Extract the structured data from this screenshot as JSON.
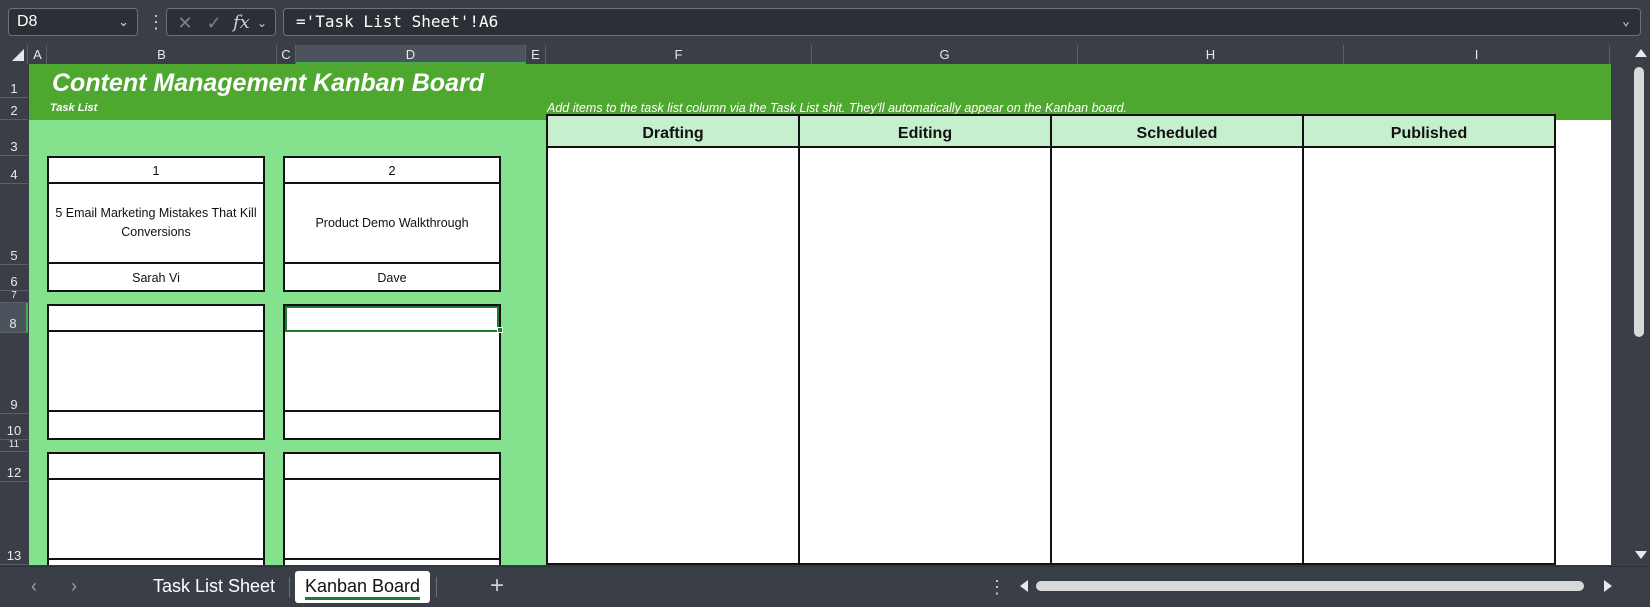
{
  "formula_bar": {
    "name_box": "D8",
    "formula": "='Task List Sheet'!A6",
    "fx_label": "fx"
  },
  "columns": [
    "A",
    "B",
    "C",
    "D",
    "E",
    "F",
    "G",
    "H",
    "I"
  ],
  "rows": [
    "1",
    "2",
    "3",
    "4",
    "5",
    "6",
    "7",
    "8",
    "9",
    "10",
    "11",
    "12",
    "13"
  ],
  "selected_cell": {
    "column": "D",
    "row": "8"
  },
  "sheet": {
    "title": "Content Management Kanban Board",
    "task_list_label": "Task List",
    "hint": "Add items to the task list column via the Task List shit. They'll automatically appear on the Kanban board.",
    "cards": [
      {
        "number": "1",
        "task": "5 Email Marketing Mistakes That Kill Conversions",
        "owner": "Sarah Vi"
      },
      {
        "number": "2",
        "task": "Product Demo Walkthrough",
        "owner": "Dave"
      },
      {
        "number": "",
        "task": "",
        "owner": ""
      },
      {
        "number": "",
        "task": "",
        "owner": ""
      },
      {
        "number": "",
        "task": "",
        "owner": ""
      },
      {
        "number": "",
        "task": "",
        "owner": ""
      }
    ],
    "kanban_columns": [
      "Drafting",
      "Editing",
      "Scheduled",
      "Published"
    ]
  },
  "tabs": {
    "sheets": [
      "Task List Sheet",
      "Kanban Board"
    ],
    "active": "Kanban Board"
  },
  "colors": {
    "band_green": "#4ea72e",
    "panel_green": "#84e28e",
    "header_mint": "#c6efce",
    "selection": "#1e7a34"
  },
  "icons": [
    "chevron-down-icon",
    "more-icon",
    "cancel-icon",
    "enter-icon",
    "insert-function-icon",
    "chevron-left-icon",
    "chevron-right-icon",
    "add-sheet-icon"
  ]
}
